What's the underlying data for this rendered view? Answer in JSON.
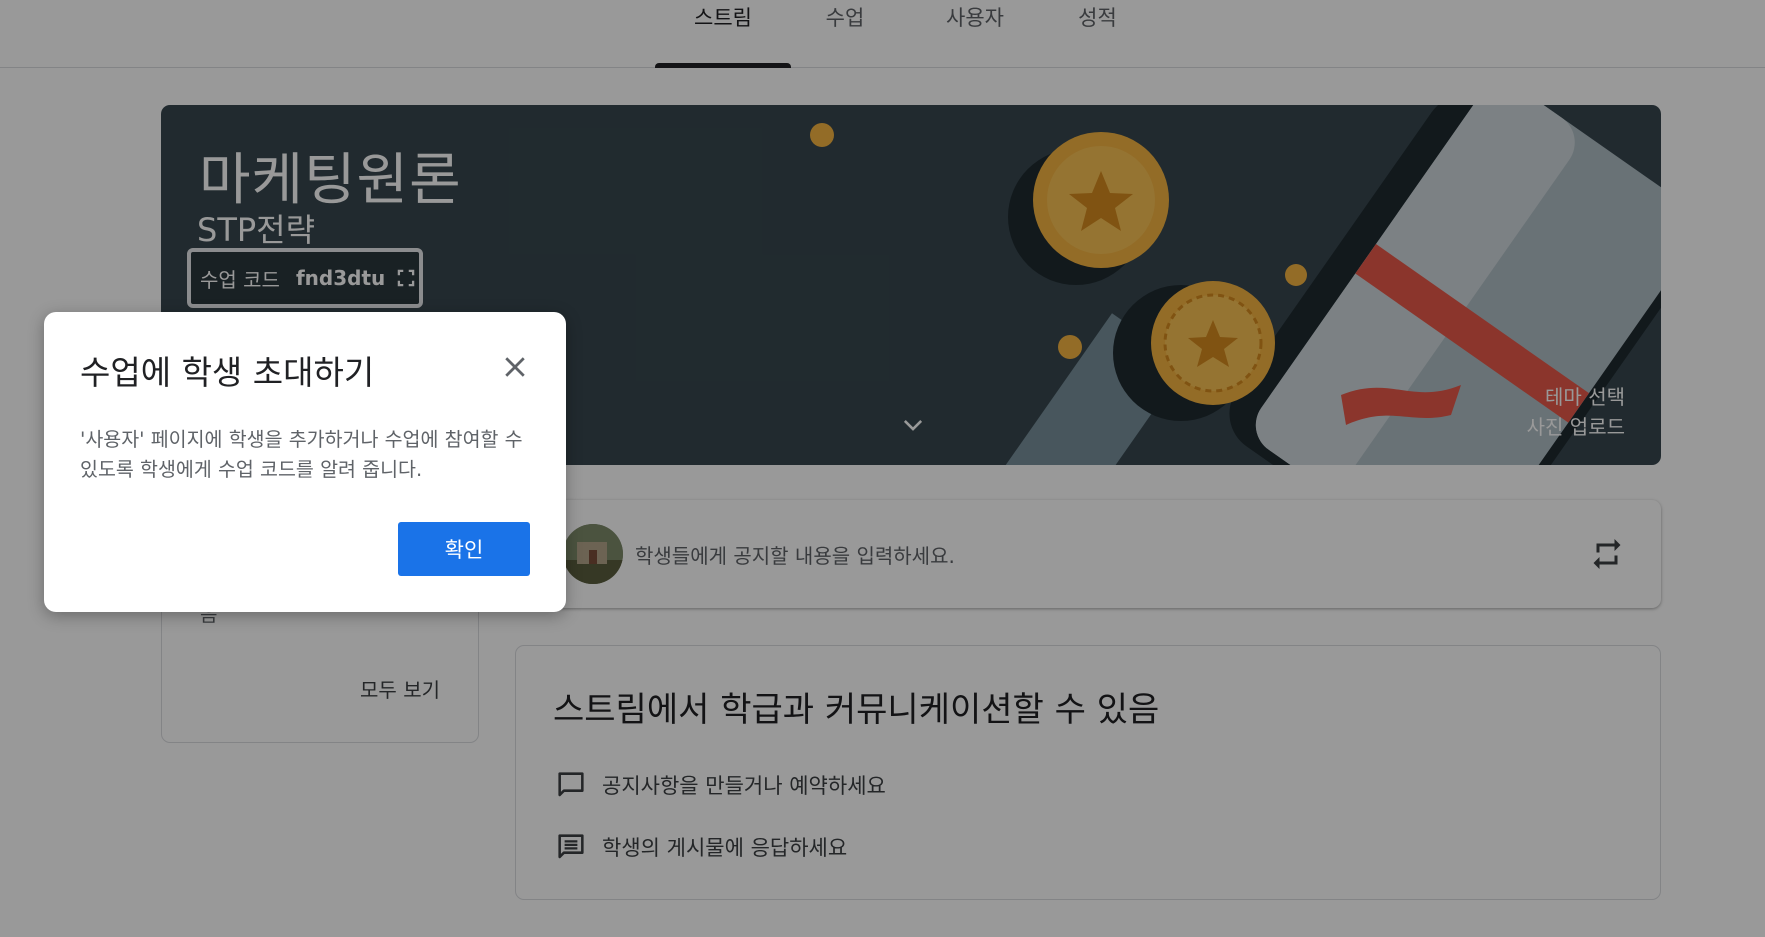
{
  "nav": {
    "tabs": [
      {
        "label": "스트림",
        "active": true
      },
      {
        "label": "수업",
        "active": false
      },
      {
        "label": "사용자",
        "active": false
      },
      {
        "label": "성적",
        "active": false
      }
    ]
  },
  "banner": {
    "title": "마케팅원론",
    "subtitle": "STP전략",
    "code_label": "수업 코드",
    "code_value": "fnd3dtu",
    "theme_select": "테마 선택",
    "photo_upload": "사진 업로드",
    "theme_colors": {
      "background": "#37474f",
      "coin": "#f6b441",
      "accent": "#e8594a"
    }
  },
  "announce": {
    "placeholder": "학생들에게 공지할 내용을 입력하세요."
  },
  "sidecard": {
    "fragment_line": "음",
    "view_all": "모두 보기"
  },
  "stream_info": {
    "heading": "스트림에서 학급과 커뮤니케이션할 수 있음",
    "items": [
      {
        "icon": "comment-icon",
        "label": "공지사항을 만들거나 예약하세요"
      },
      {
        "icon": "message-icon",
        "label": "학생의 게시물에 응답하세요"
      }
    ]
  },
  "dialog": {
    "title": "수업에 학생 초대하기",
    "body": "'사용자' 페이지에 학생을 추가하거나 수업에 참여할 수 있도록 학생에게 수업 코드를 알려 줍니다.",
    "confirm": "확인",
    "accent": "#1a73e8"
  }
}
